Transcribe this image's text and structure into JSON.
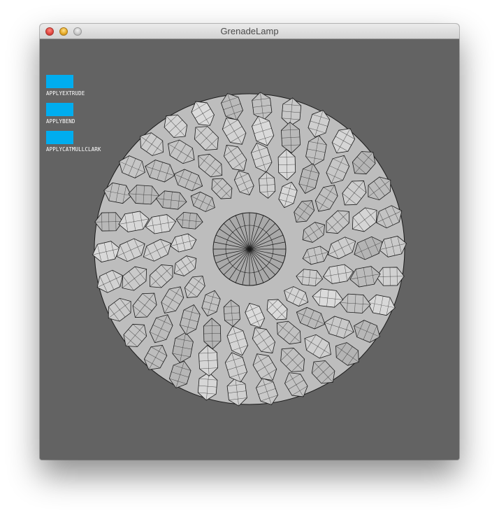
{
  "window": {
    "title": "GrenadeLamp"
  },
  "controls": [
    {
      "label": "APPLYEXTRUDE",
      "color": "#00adef"
    },
    {
      "label": "APPLYBEND",
      "color": "#00adef"
    },
    {
      "label": "APPLYCATMULLCLARK",
      "color": "#00adef"
    }
  ],
  "canvas": {
    "background": "#636363",
    "mesh_fill": "#c4c4c4",
    "mesh_stroke": "#1a1a1a"
  }
}
